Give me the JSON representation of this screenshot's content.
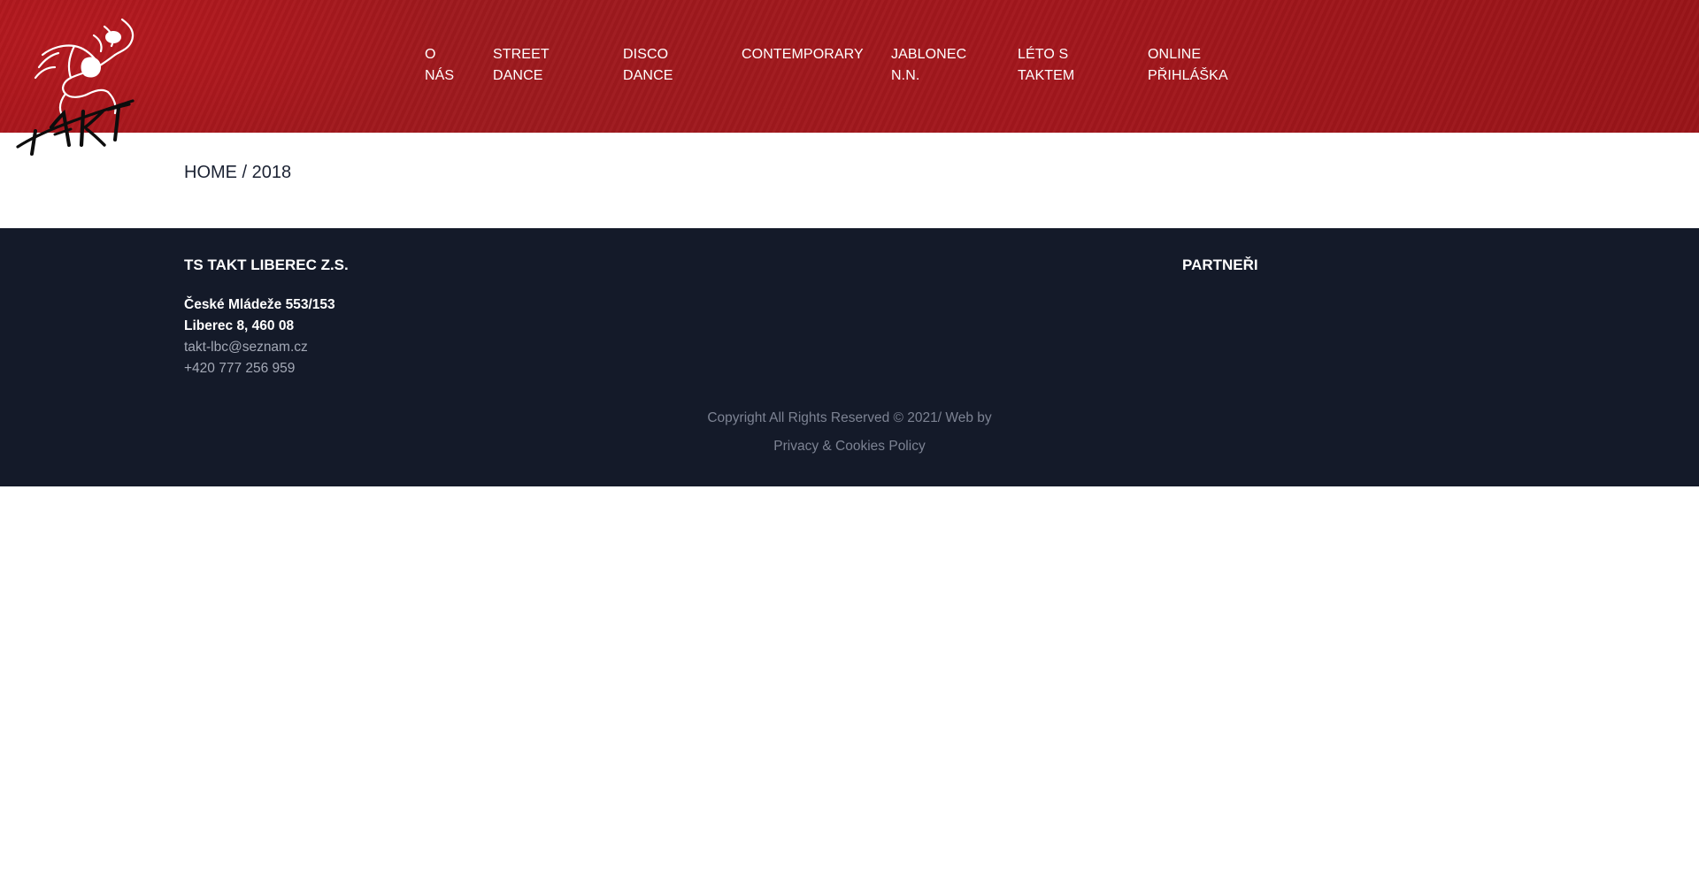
{
  "header": {
    "logo_name": "TAKT",
    "nav": [
      {
        "label": "O\nNÁS"
      },
      {
        "label": "STREET\nDANCE"
      },
      {
        "label": "DISCO\nDANCE"
      },
      {
        "label": "CONTEMPORARY"
      },
      {
        "label": "JABLONEC\nN.N."
      },
      {
        "label": "LÉTO S\nTAKTEM"
      },
      {
        "label": "ONLINE\nPŘIHLÁŠKA"
      }
    ]
  },
  "breadcrumb": {
    "home": "HOME",
    "separator": " / ",
    "current": "2018"
  },
  "footer": {
    "org_title": "TS TAKT LIBEREC Z.S.",
    "address_line1": "České Mládeže 553/153",
    "address_line2": "Liberec 8, 460 08",
    "email": "takt-lbc@seznam.cz",
    "phone": "+420 777 256 959",
    "partners_title": "PARTNEŘI",
    "copyright": "Copyright All Rights Reserved © 2021/ Web by",
    "policy_link": "Privacy & Cookies Policy"
  },
  "colors": {
    "header_red": "#a3171d",
    "footer_navy": "#141a29",
    "text_dark": "#1b2233",
    "footer_muted": "#7d8393"
  }
}
